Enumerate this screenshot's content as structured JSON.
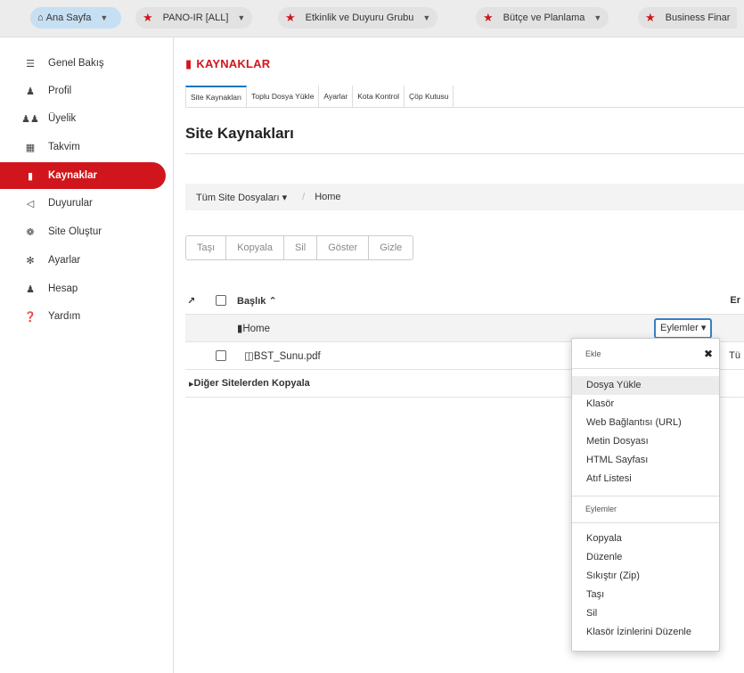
{
  "topbar": {
    "home": {
      "label": "Ana Sayfa"
    },
    "sites": [
      {
        "label": "PANO-IR [ALL]"
      },
      {
        "label": "Etkinlik ve Duyuru Grubu"
      },
      {
        "label": "Bütçe ve Planlama"
      },
      {
        "label": "Business Finar"
      }
    ]
  },
  "sidebar": {
    "items": [
      {
        "label": "Genel Bakış",
        "icon": "list-icon",
        "active": false
      },
      {
        "label": "Profil",
        "icon": "user-icon",
        "active": false
      },
      {
        "label": "Üyelik",
        "icon": "users-icon",
        "active": false
      },
      {
        "label": "Takvim",
        "icon": "calendar-icon",
        "active": false
      },
      {
        "label": "Kaynaklar",
        "icon": "folder-open-icon",
        "active": true
      },
      {
        "label": "Duyurular",
        "icon": "bullhorn-icon",
        "active": false
      },
      {
        "label": "Site Oluştur",
        "icon": "cogs-icon",
        "active": false
      },
      {
        "label": "Ayarlar",
        "icon": "gear-icon",
        "active": false
      },
      {
        "label": "Hesap",
        "icon": "user-icon",
        "active": false
      },
      {
        "label": "Yardım",
        "icon": "question-circle-icon",
        "active": false
      }
    ]
  },
  "main": {
    "tool_title": "KAYNAKLAR",
    "tabs": [
      {
        "label": "Site Kaynakları",
        "active": true
      },
      {
        "label": "Toplu Dosya Yükle",
        "active": false
      },
      {
        "label": "Ayarlar",
        "active": false
      },
      {
        "label": "Kota Kontrol",
        "active": false
      },
      {
        "label": "Çöp Kutusu",
        "active": false
      }
    ],
    "heading": "Site Kaynakları",
    "breadcrumb": {
      "root": "Tüm Site Dosyaları",
      "current": "Home"
    },
    "actions": [
      "Taşı",
      "Kopyala",
      "Sil",
      "Göster",
      "Gizle"
    ],
    "table": {
      "title_header": "Başlık",
      "right_header": "Er",
      "rows": [
        {
          "title": "Home",
          "type": "folder",
          "action_button": "Eylemler"
        },
        {
          "title": "BST_Sunu.pdf",
          "type": "pdf",
          "right_text": "Tü"
        }
      ],
      "other_sites": "Diğer Sitelerden Kopyala"
    }
  },
  "dropdown": {
    "header": "Ekle",
    "add_items": [
      "Dosya Yükle",
      "Klasör",
      "Web Bağlantısı (URL)",
      "Metin Dosyası",
      "HTML Sayfası",
      "Atıf Listesi"
    ],
    "section_label": "Eylemler",
    "action_items": [
      "Kopyala",
      "Düzenle",
      "Sıkıştır (Zip)",
      "Taşı",
      "Sil",
      "Klasör İzinlerini Düzenle"
    ]
  },
  "colors": {
    "accent": "#d0161c",
    "focus": "#3a7ec2"
  }
}
